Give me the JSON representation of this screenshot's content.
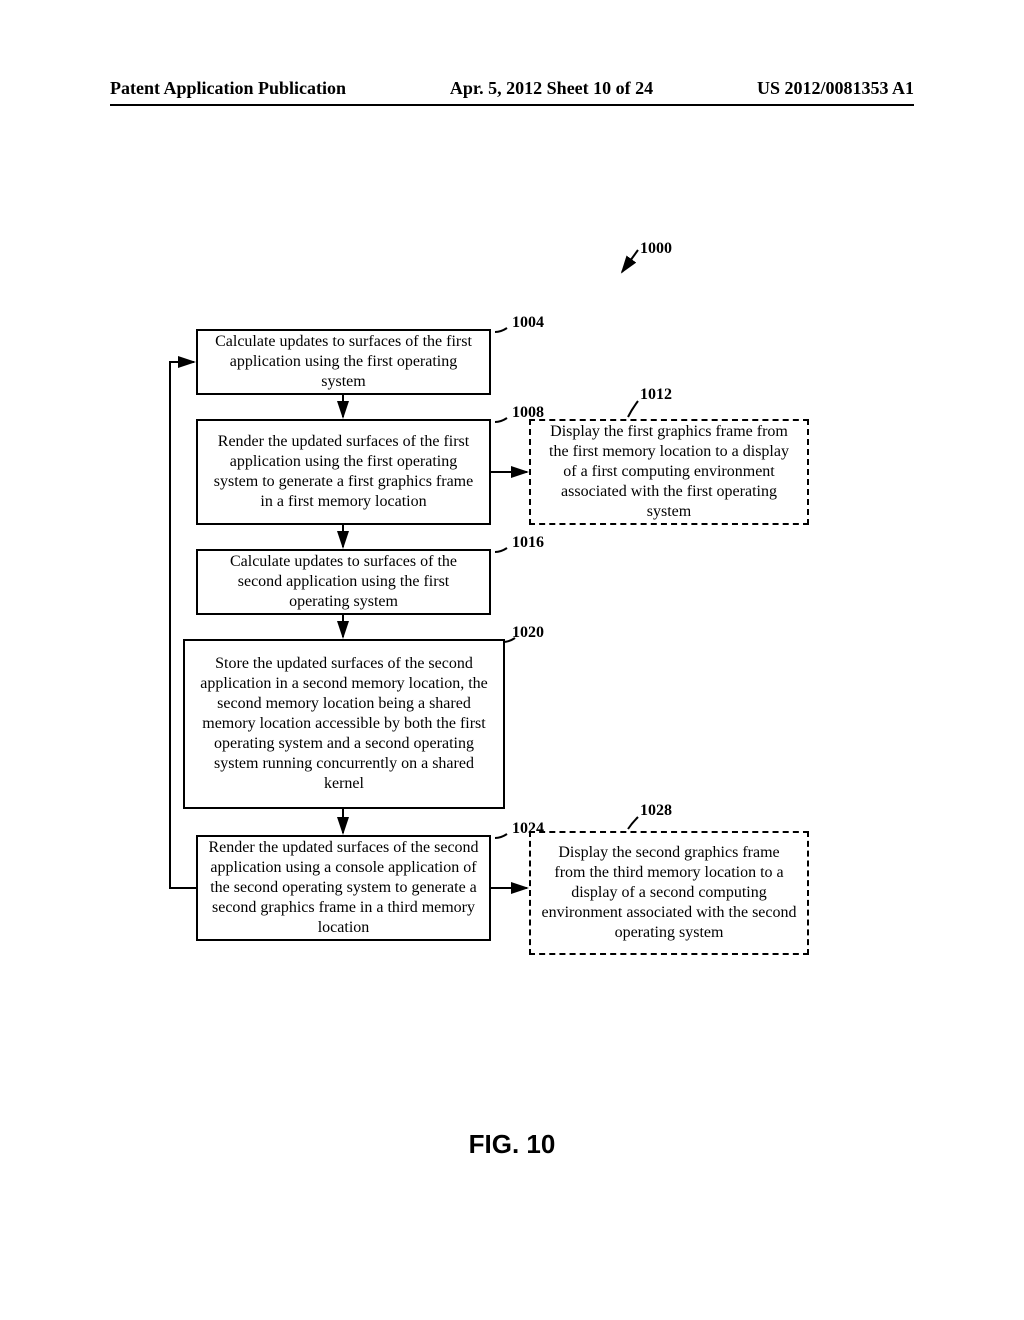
{
  "header": {
    "left": "Patent Application Publication",
    "center": "Apr. 5, 2012  Sheet 10 of 24",
    "right": "US 2012/0081353 A1"
  },
  "figure": {
    "label": "FIG. 10",
    "main_ref": "1000"
  },
  "boxes": {
    "b1004": {
      "ref": "1004",
      "text": "Calculate updates to surfaces of the first application using the first operating system"
    },
    "b1008": {
      "ref": "1008",
      "text": "Render the updated surfaces of the first application using the first operating system to generate a first graphics frame in a first memory location"
    },
    "b1012": {
      "ref": "1012",
      "text": "Display the first graphics frame from the first memory location to a display of a first computing environment associated with the first operating system"
    },
    "b1016": {
      "ref": "1016",
      "text": "Calculate updates to surfaces of the second application using the first operating system"
    },
    "b1020": {
      "ref": "1020",
      "text": "Store the updated surfaces of the second application in a second memory location, the second memory location being a shared memory location accessible by both the first operating system and a second operating system running concurrently on a shared kernel"
    },
    "b1024": {
      "ref": "1024",
      "text": "Render the updated surfaces of the second application using a console application of the second operating system to generate a second graphics frame in a third memory location"
    },
    "b1028": {
      "ref": "1028",
      "text": "Display the second graphics frame from the third memory location to a display of a second computing environment associated with the second operating system"
    }
  }
}
